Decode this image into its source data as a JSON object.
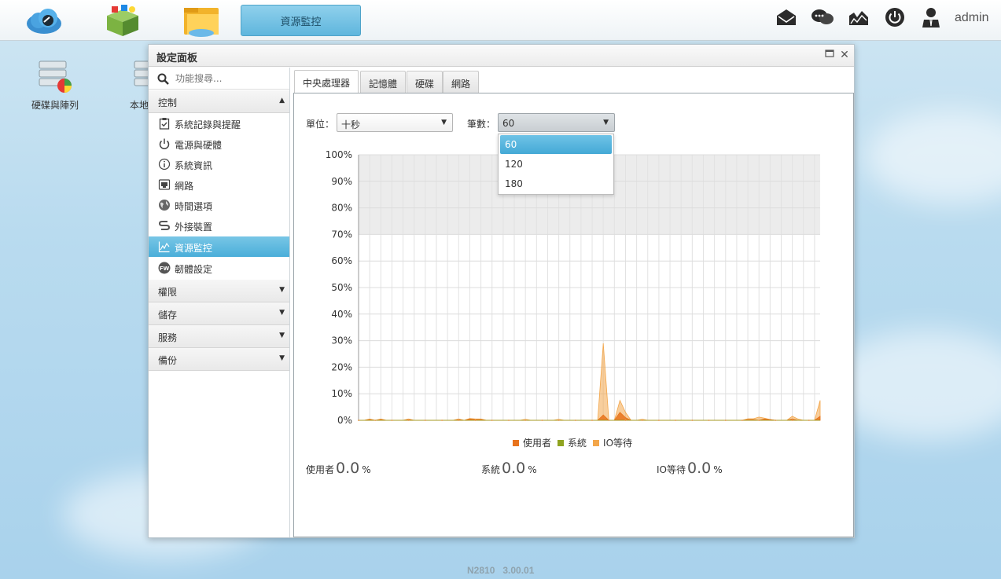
{
  "taskbar": {
    "active_app_label": "資源監控",
    "user": "admin"
  },
  "desktop": {
    "icons": [
      {
        "label": "硬碟與陣列"
      },
      {
        "label": "本地"
      }
    ]
  },
  "panel": {
    "title": "設定面板",
    "sidebar": {
      "search_placeholder": "功能搜尋...",
      "sections": [
        {
          "label": "控制",
          "expanded": true
        },
        {
          "label": "權限"
        },
        {
          "label": "儲存"
        },
        {
          "label": "服務"
        },
        {
          "label": "備份"
        }
      ],
      "items": [
        {
          "label": "系統記錄與提醒",
          "icon": "clipboard-icon"
        },
        {
          "label": "電源與硬體",
          "icon": "power-icon"
        },
        {
          "label": "系統資訊",
          "icon": "info-icon"
        },
        {
          "label": "網路",
          "icon": "network-icon"
        },
        {
          "label": "時間選項",
          "icon": "globe-icon"
        },
        {
          "label": "外接裝置",
          "icon": "usb-icon"
        },
        {
          "label": "資源監控",
          "icon": "chart-icon",
          "active": true
        },
        {
          "label": "韌體設定",
          "icon": "firmware-icon"
        }
      ]
    },
    "tabs": [
      {
        "label": "中央處理器",
        "active": true
      },
      {
        "label": "記憶體"
      },
      {
        "label": "硬碟"
      },
      {
        "label": "網路"
      }
    ],
    "controls": {
      "unit_label": "單位：",
      "unit_value": "十秒",
      "count_label": "筆數：",
      "count_value": "60",
      "count_options": [
        "60",
        "120",
        "180"
      ]
    },
    "stats": {
      "user_label": "使用者",
      "user_value": "0.0",
      "system_label": "系統",
      "system_value": "0.0",
      "iowait_label": "IO等待",
      "iowait_value": "0.0",
      "unit": "%"
    }
  },
  "chart_data": {
    "type": "area",
    "y_ticks": [
      "0%",
      "10%",
      "20%",
      "30%",
      "40%",
      "50%",
      "60%",
      "70%",
      "80%",
      "90%",
      "100%"
    ],
    "ylim": [
      0,
      100
    ],
    "highlight_band": [
      70,
      100
    ],
    "grid": true,
    "legend_position": "bottom-center",
    "series": [
      {
        "name": "使用者",
        "color": "#e8731c",
        "values": [
          0,
          0,
          0.3,
          0,
          0.3,
          0,
          0,
          0,
          0,
          0.3,
          0,
          0,
          0,
          0,
          0,
          0,
          0,
          0,
          0.3,
          0,
          0.5,
          0.3,
          0.3,
          0,
          0,
          0,
          0,
          0,
          0,
          0,
          0,
          0,
          0,
          0,
          0,
          0,
          0,
          0,
          0,
          0,
          0,
          0,
          0,
          0,
          2,
          0,
          0,
          3,
          1,
          0,
          0,
          0,
          0,
          0,
          0,
          0,
          0,
          0,
          0,
          0,
          0,
          0,
          0,
          0,
          0,
          0,
          0,
          0,
          0,
          0,
          0.3,
          0.3,
          0,
          0.5,
          0.3,
          0,
          0,
          0,
          0.5,
          0,
          0,
          0,
          0,
          1.5
        ]
      },
      {
        "name": "系統",
        "color": "#8fa31f",
        "values": [
          0,
          0,
          0,
          0,
          0,
          0,
          0,
          0,
          0,
          0,
          0,
          0,
          0,
          0,
          0,
          0,
          0,
          0,
          0,
          0,
          0,
          0,
          0,
          0,
          0,
          0,
          0,
          0,
          0,
          0,
          0,
          0,
          0,
          0,
          0,
          0,
          0,
          0,
          0,
          0,
          0,
          0,
          0,
          0,
          0,
          0,
          0,
          0,
          0,
          0,
          0,
          0,
          0,
          0,
          0,
          0,
          0,
          0,
          0,
          0,
          0,
          0,
          0,
          0,
          0,
          0,
          0,
          0,
          0,
          0,
          0,
          0,
          0,
          0,
          0,
          0,
          0,
          0,
          0,
          0,
          0,
          0,
          0,
          0
        ]
      },
      {
        "name": "IO等待",
        "color": "#f3a64a",
        "values": [
          0,
          0,
          0.5,
          0,
          0.5,
          0,
          0,
          0,
          0,
          0.5,
          0,
          0,
          0,
          0,
          0,
          0,
          0,
          0,
          0.5,
          0,
          0.7,
          0.5,
          0.5,
          0,
          0,
          0,
          0,
          0,
          0,
          0,
          0.4,
          0,
          0,
          0,
          0,
          0,
          0.4,
          0,
          0,
          0,
          0,
          0,
          0,
          0,
          29,
          0,
          0,
          7.5,
          3,
          0,
          0,
          0.4,
          0,
          0,
          0,
          0,
          0,
          0,
          0,
          0,
          0,
          0,
          0,
          0,
          0,
          0,
          0,
          0,
          0,
          0,
          0.6,
          0.6,
          1.2,
          0.8,
          0.3,
          0,
          0,
          0,
          1.5,
          0.5,
          0,
          0,
          0,
          7.5
        ]
      }
    ]
  }
}
